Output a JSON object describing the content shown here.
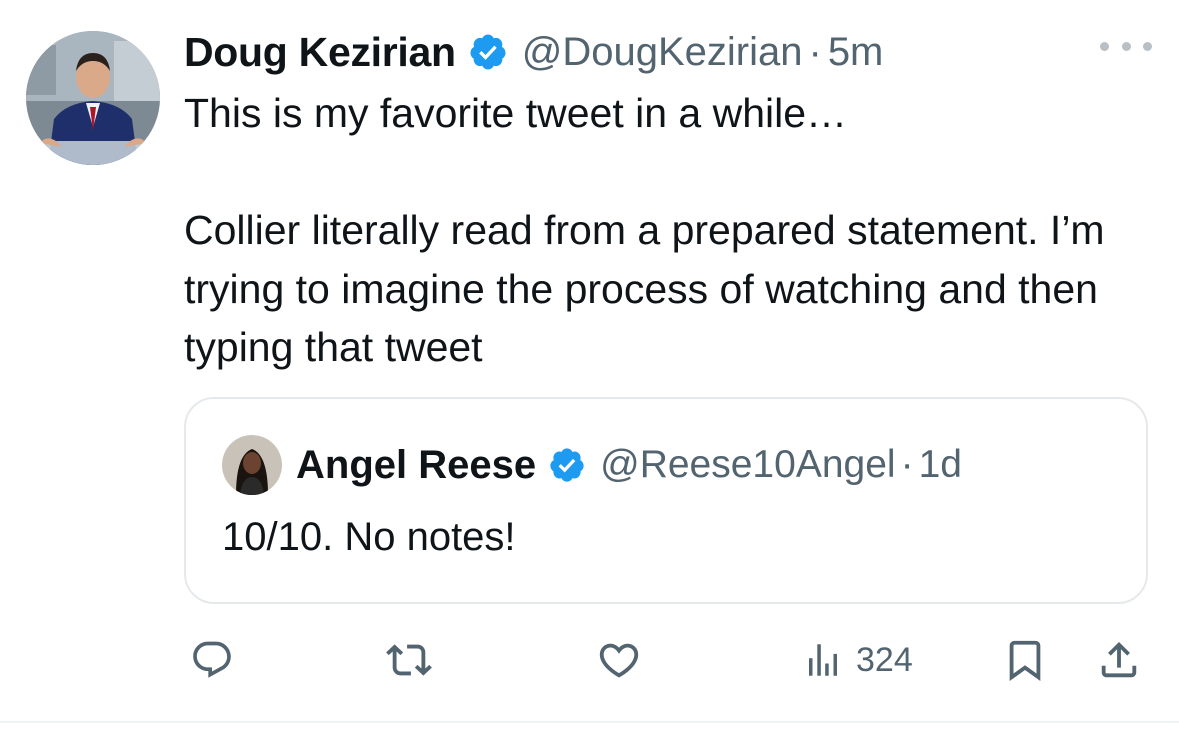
{
  "tweet": {
    "author": {
      "name": "Doug Kezirian",
      "handle": "@DougKezirian",
      "verified": true,
      "avatar": "avatar-photo"
    },
    "separator": "·",
    "time": "5m",
    "text": "This is my favorite tweet in a while…\n\nCollier literally read from a prepared statement. I’m trying to imagine the process of watching and then typing that tweet",
    "more_icon": "more-horizontal-icon"
  },
  "quoted_tweet": {
    "author": {
      "name": "Angel Reese",
      "handle": "@Reese10Angel",
      "verified": true,
      "avatar": "avatar-photo"
    },
    "separator": "·",
    "time": "1d",
    "text": "10/10. No notes!"
  },
  "actions": {
    "reply_icon": "reply-icon",
    "retweet_icon": "retweet-icon",
    "like_icon": "heart-icon",
    "views_icon": "views-icon",
    "views_count": "324",
    "bookmark_icon": "bookmark-icon",
    "share_icon": "share-icon"
  },
  "colors": {
    "text": "#0f1419",
    "secondary": "#536471",
    "verified": "#1d9bf0",
    "border": "#e6e9ec"
  }
}
